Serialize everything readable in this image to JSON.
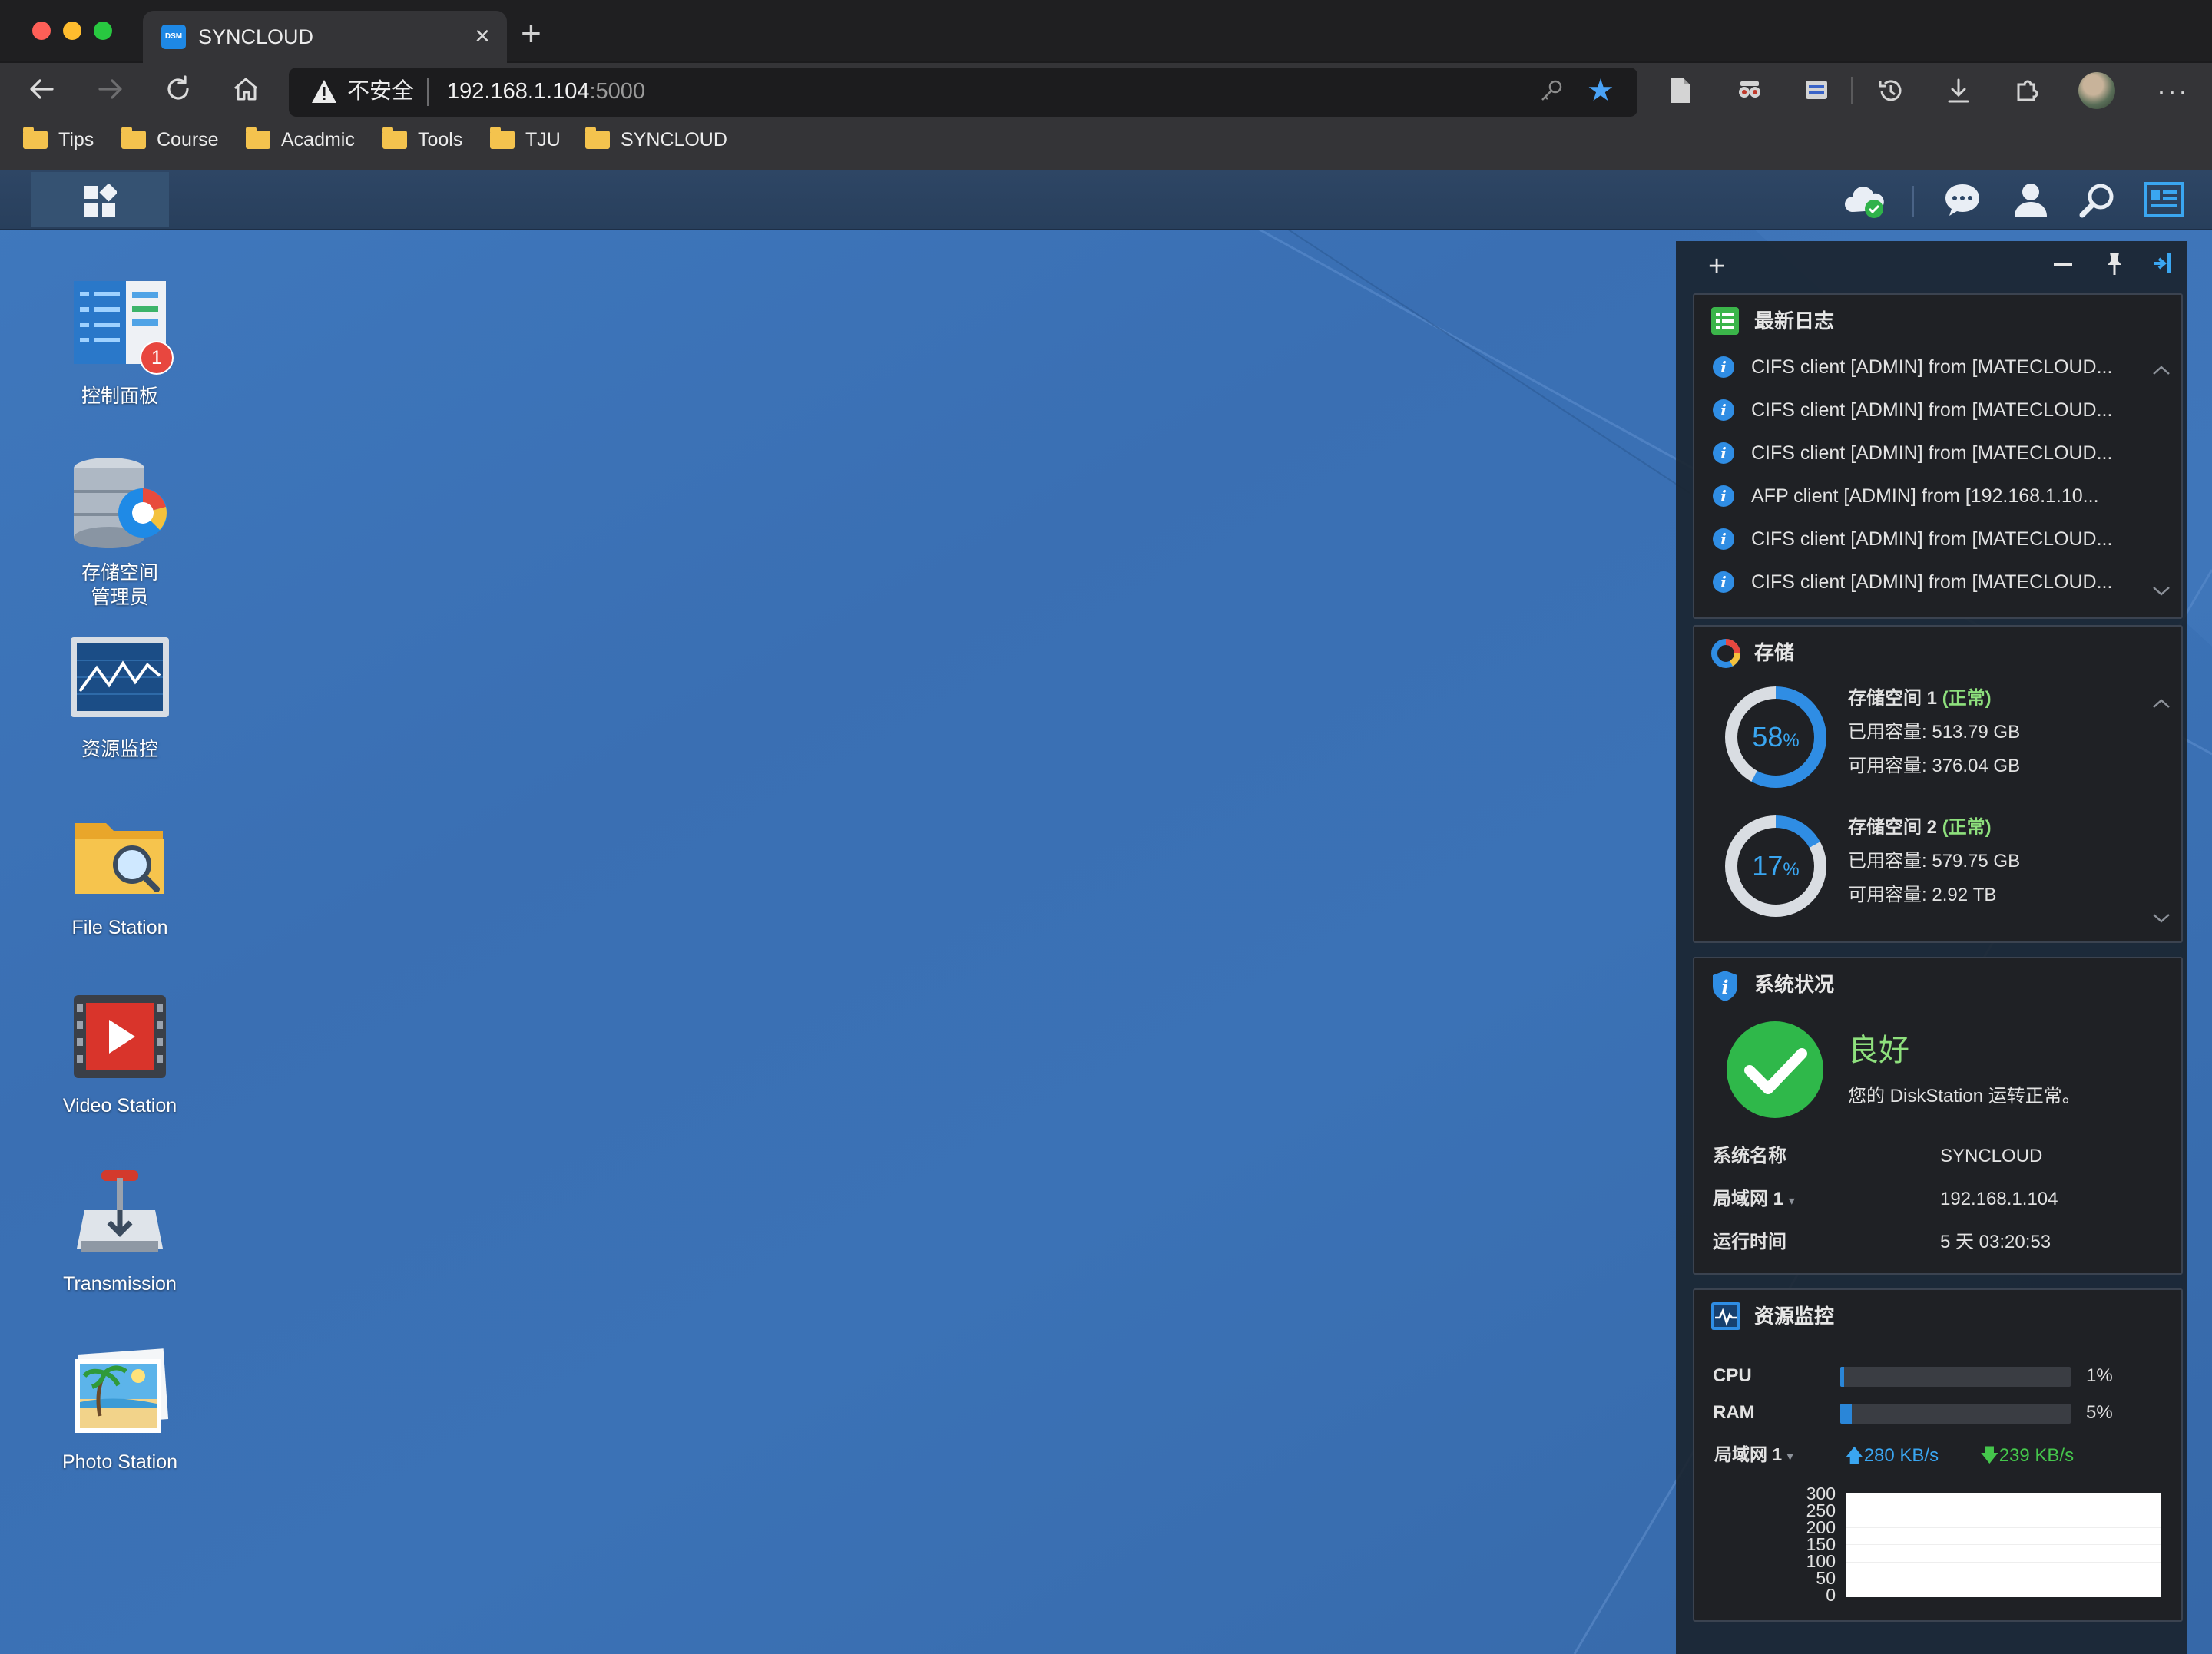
{
  "browser": {
    "tab_title": "SYNCLOUD",
    "tab_favicon": "DSM",
    "security_label": "不安全",
    "url_host": "192.168.1.104",
    "url_port": ":5000",
    "bookmarks": [
      "Tips",
      "Course",
      "Acadmic",
      "Tools",
      "TJU",
      "SYNCLOUD"
    ]
  },
  "desktop": {
    "icons": [
      {
        "label": "控制面板",
        "badge": "1"
      },
      {
        "label": "存储空间\n管理员"
      },
      {
        "label": "资源监控"
      },
      {
        "label": "File Station"
      },
      {
        "label": "Video Station"
      },
      {
        "label": "Transmission"
      },
      {
        "label": "Photo Station"
      }
    ]
  },
  "widgets": {
    "log": {
      "title": "最新日志",
      "entries": [
        "CIFS client [ADMIN] from [MATECLOUD...",
        "CIFS client [ADMIN] from [MATECLOUD...",
        "CIFS client [ADMIN] from [MATECLOUD...",
        "AFP client [ADMIN] from [192.168.1.10...",
        "CIFS client [ADMIN] from [MATECLOUD...",
        "CIFS client [ADMIN] from [MATECLOUD..."
      ]
    },
    "storage": {
      "title": "存储",
      "volumes": [
        {
          "name": "存储空间 1",
          "status": "(正常)",
          "percent": 58,
          "percent_text": "58",
          "used_label": "已用容量:",
          "used": "513.79 GB",
          "free_label": "可用容量:",
          "free": "376.04 GB"
        },
        {
          "name": "存储空间 2",
          "status": "(正常)",
          "percent": 17,
          "percent_text": "17",
          "used_label": "已用容量:",
          "used": "579.75 GB",
          "free_label": "可用容量:",
          "free": "2.92 TB"
        }
      ],
      "percent_sign": "%"
    },
    "system": {
      "title": "系统状况",
      "status": "良好",
      "message": "您的 DiskStation 运转正常。",
      "rows": [
        {
          "key": "系统名称",
          "value": "SYNCLOUD"
        },
        {
          "key": "局域网 1",
          "value": "192.168.1.104"
        },
        {
          "key": "运行时间",
          "value": "5 天 03:20:53"
        }
      ]
    },
    "resource": {
      "title": "资源监控",
      "cpu_label": "CPU",
      "cpu_value": 1,
      "cpu_text": "1%",
      "ram_label": "RAM",
      "ram_value": 5,
      "ram_text": "5%",
      "net_label": "局域网 1",
      "upload": "280 KB/s",
      "download": "239 KB/s",
      "y_ticks": [
        "300",
        "250",
        "200",
        "150",
        "100",
        "50",
        "0"
      ]
    }
  },
  "colors": {
    "accent_blue": "#2f8de4",
    "status_green": "#3fbf3f",
    "badge_red": "#e8473f",
    "desktop_blue": "#3a6fb3"
  }
}
